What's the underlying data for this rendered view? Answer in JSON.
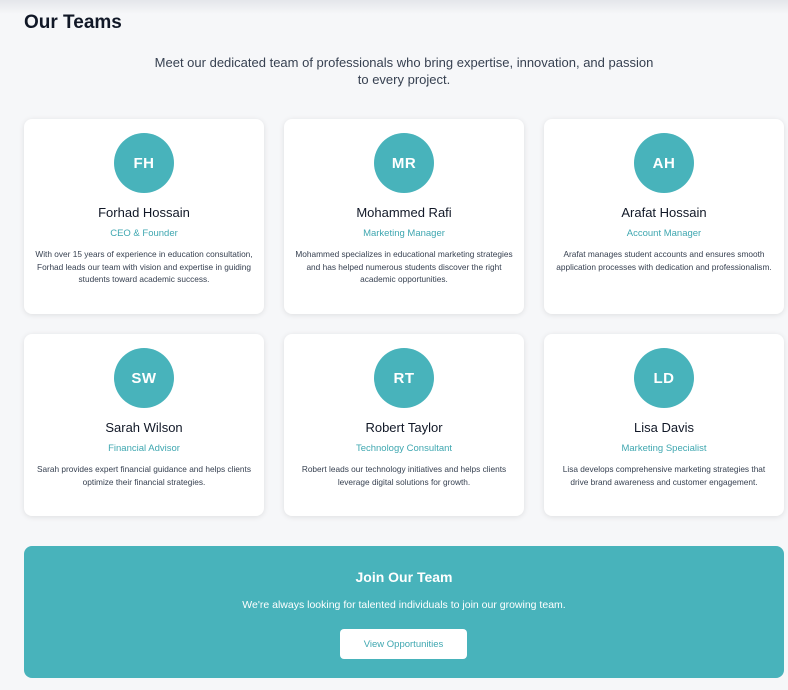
{
  "header": {
    "title": "Our Teams",
    "intro": "Meet our dedicated team of professionals who bring expertise, innovation, and passion to every project."
  },
  "team": [
    {
      "initials": "FH",
      "name": "Forhad Hossain",
      "role": "CEO & Founder",
      "bio": "With over 15 years of experience in education consultation, Forhad leads our team with vision and expertise in guiding students toward academic success."
    },
    {
      "initials": "MR",
      "name": "Mohammed Rafi",
      "role": "Marketing Manager",
      "bio": "Mohammed specializes in educational marketing strategies and has helped numerous students discover the right academic opportunities."
    },
    {
      "initials": "AH",
      "name": "Arafat Hossain",
      "role": "Account Manager",
      "bio": "Arafat manages student accounts and ensures smooth application processes with dedication and professionalism."
    },
    {
      "initials": "SW",
      "name": "Sarah Wilson",
      "role": "Financial Advisor",
      "bio": "Sarah provides expert financial guidance and helps clients optimize their financial strategies."
    },
    {
      "initials": "RT",
      "name": "Robert Taylor",
      "role": "Technology Consultant",
      "bio": "Robert leads our technology initiatives and helps clients leverage digital solutions for growth."
    },
    {
      "initials": "LD",
      "name": "Lisa Davis",
      "role": "Marketing Specialist",
      "bio": "Lisa develops comprehensive marketing strategies that drive brand awareness and customer engagement."
    }
  ],
  "cta": {
    "title": "Join Our Team",
    "text": "We're always looking for talented individuals to join our growing team.",
    "button_label": "View Opportunities"
  },
  "colors": {
    "accent": "#48b3bb",
    "accent_text": "#3fa7b0",
    "background": "#f6f7f9",
    "card": "#ffffff"
  }
}
